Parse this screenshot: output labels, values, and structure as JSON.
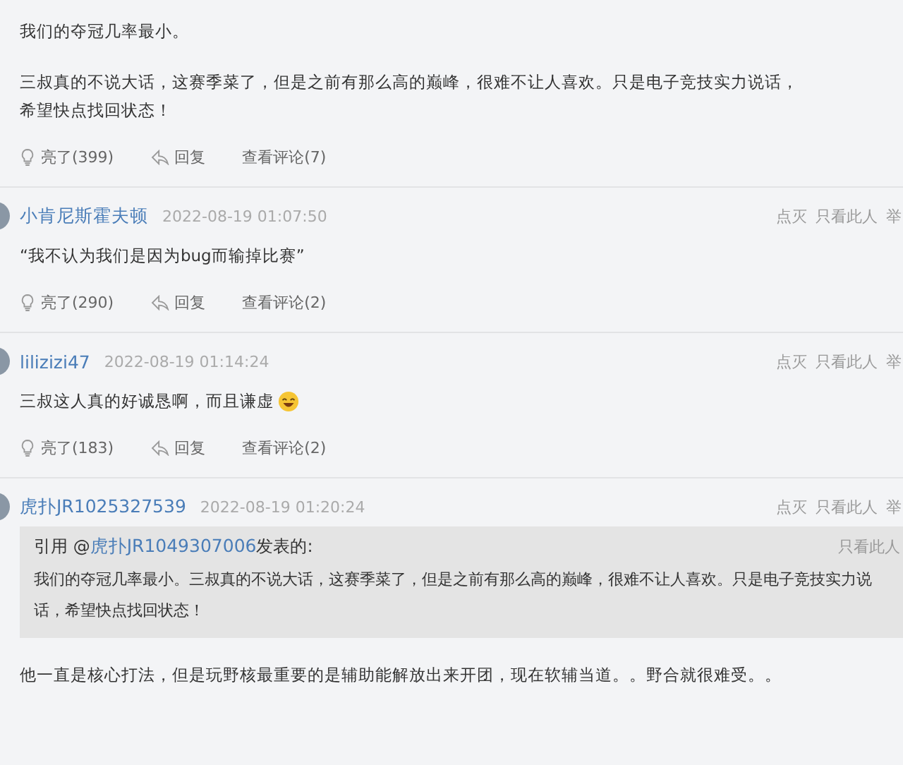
{
  "posts": [
    {
      "paragraphs": [
        {
          "text": "我们的夺冠几率最小。"
        },
        {
          "text": "三叔真的不说大话，这赛季菜了，但是之前有那么高的巅峰，很难不让人喜欢。只是电子竞技实力说话，希望快点找回状态！"
        }
      ],
      "footer": {
        "like": "亮了(399)",
        "reply": "回复",
        "comments": "查看评论(7)"
      }
    },
    {
      "author": "小肯尼斯霍夫顿",
      "time": "2022-08-19 01:07:50",
      "header_actions": [
        "点灭",
        "只看此人",
        "举"
      ],
      "paragraphs": [
        {
          "text": "“我不认为我们是因为bug而输掉比赛”"
        }
      ],
      "footer": {
        "like": "亮了(290)",
        "reply": "回复",
        "comments": "查看评论(2)"
      }
    },
    {
      "author": "lilizizi47",
      "time": "2022-08-19 01:14:24",
      "header_actions": [
        "点灭",
        "只看此人",
        "举"
      ],
      "paragraphs": [
        {
          "text": "三叔这人真的好诚恳啊，而且谦虚",
          "emoji": true
        }
      ],
      "footer": {
        "like": "亮了(183)",
        "reply": "回复",
        "comments": "查看评论(2)"
      }
    },
    {
      "author": "虎扑JR1025327539",
      "time": "2022-08-19 01:20:24",
      "header_actions": [
        "点灭",
        "只看此人",
        "举"
      ],
      "quote": {
        "prefix": "引用 @",
        "user": "虎扑JR1049307006",
        "suffix": "发表的:",
        "action": "只看此人",
        "text": "我们的夺冠几率最小。三叔真的不说大话，这赛季菜了，但是之前有那么高的巅峰，很难不让人喜欢。只是电子竞技实力说话，希望快点找回状态！"
      },
      "paragraphs": [
        {
          "text": "他一直是核心打法，但是玩野核最重要的是辅助能解放出来开团，现在软辅当道。。野合就很难受。。"
        }
      ]
    }
  ]
}
